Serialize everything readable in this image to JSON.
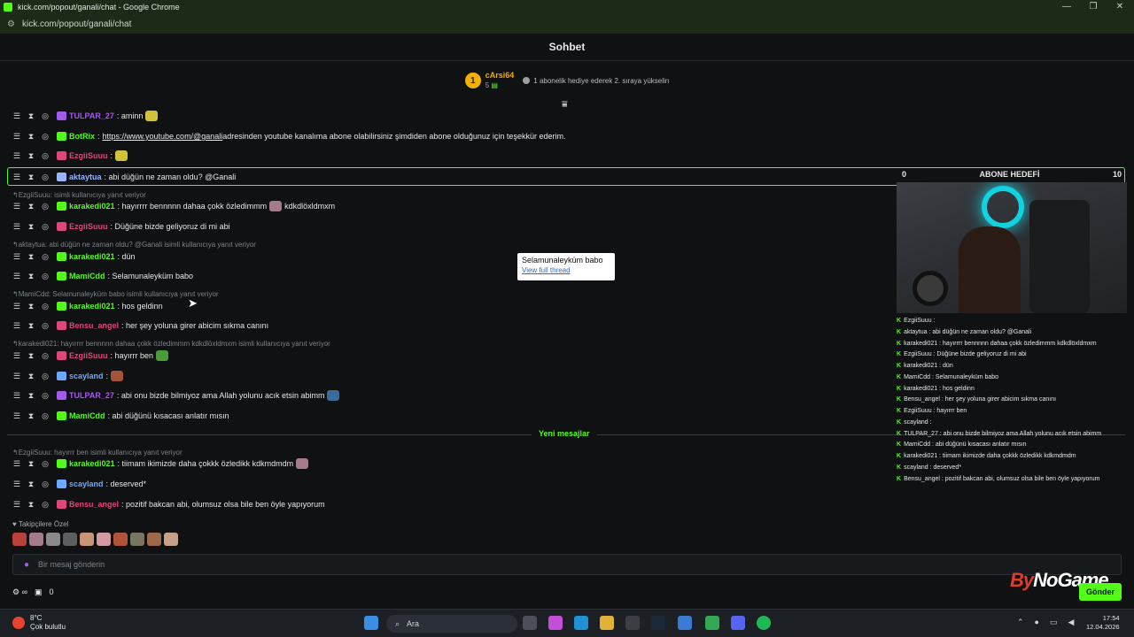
{
  "window": {
    "title": "kick.com/popout/ganali/chat - Google Chrome",
    "url": "kick.com/popout/ganali/chat"
  },
  "chat": {
    "title": "Sohbet"
  },
  "pinned": {
    "user": "cArsi64",
    "rank": "1",
    "count": "5",
    "hint": "1 abonelik hediye ederek 2. sıraya yükselin"
  },
  "messages": [
    {
      "user": "TULPAR_27",
      "color": "#a25be8",
      "text": ": aminn",
      "emote": true
    },
    {
      "user": "BotRix",
      "color": "#53fc18",
      "text": ":",
      "link": "https://www.youtube.com/@ganali",
      "after": " adresinden youtube kanalıma abone olabilirsiniz şimdiden abone olduğunuz için teşekkür ederim."
    },
    {
      "user": "EzgiiSuuu",
      "color": "#e0457b",
      "text": ":",
      "emote": true
    },
    {
      "user": "aktaytua",
      "color": "#9ab4ff",
      "text": ": abi düğün ne zaman oldu? @Ganali"
    },
    {
      "user": "karakedi021",
      "color": "#53fc18",
      "text": ": hayırrrr bennnnn dahaa çokk özledimmm",
      "after": " kdkdlöxldmxm",
      "emote": true
    },
    {
      "user": "EzgiiSuuu",
      "color": "#e0457b",
      "text": ": Düğüne bizde geliyoruz di mi abi"
    },
    {
      "user": "karakedi021",
      "color": "#53fc18",
      "text": ": dün"
    },
    {
      "user": "MamiCdd",
      "color": "#53fc18",
      "text": ": Selamunaleyküm babo"
    },
    {
      "user": "karakedi021",
      "color": "#53fc18",
      "text": ": hos geldinn"
    },
    {
      "user": "Bensu_angel",
      "color": "#e0457b",
      "text": ": her şey yoluna girer abicim sıkma canını"
    },
    {
      "user": "EzgiiSuuu",
      "color": "#e0457b",
      "text": ": hayırrr ben",
      "emote": true
    },
    {
      "user": "scayland",
      "color": "#6fa8ff",
      "text": ":",
      "emote": true
    },
    {
      "user": "TULPAR_27",
      "color": "#a25be8",
      "text": ": abi onu bizde bilmiyoz ama Allah yolunu acık etsin abimm",
      "emote": true
    },
    {
      "user": "MamiCdd",
      "color": "#53fc18",
      "text": ": abi düğünü kısacası anlatır mısın"
    },
    {
      "user": "karakedi021",
      "color": "#53fc18",
      "text": ": tiimam ikimizde daha çokkk özledikk kdkmdmdm",
      "emote": true
    },
    {
      "user": "scayland",
      "color": "#6fa8ff",
      "text": ": deserved*"
    },
    {
      "user": "Bensu_angel",
      "color": "#e0457b",
      "text": ": pozitif bakcan abi, olumsuz olsa bile ben öyle yapıyorum"
    }
  ],
  "replies": {
    "r1": "EzgiiSuuu: isimli kullanıcıya yanıt veriyor",
    "r2": "aktaytua: abi düğün ne zaman oldu? @Ganali isimli kullanıcıya yanıt veriyor",
    "r3": "MamiCdd: Selamunaleyküm babo isimli kullanıcıya yanıt veriyor",
    "r4": "karakedi021: hayırrrr bennnnn dahaa çokk özledimmm kdkdlöxldmxm isimli kullanıcıya yanıt veriyor",
    "r5": "EzgiiSuuu: hayırrr ben isimli kullanıcıya yanıt veriyor"
  },
  "divider": {
    "label": "Yeni mesajlar"
  },
  "tooltip": {
    "text": "Selamunaleyküm babo",
    "link": "View full thread"
  },
  "followers_label": "Takipçilere Özel",
  "input": {
    "placeholder": "Bir mesaj gönderin",
    "send_label": "Gönder",
    "count": "0"
  },
  "overlay": {
    "goal_left": "0",
    "goal_label": "ABONE HEDEFİ",
    "goal_right": "10"
  },
  "mini_chat": [
    "EzgiiSuuu :",
    "aktaytua : abi düğün ne zaman oldu? @Ganali",
    "karakedi021 : hayırrrr bennnnn dahaa çokk özledimmm kdkdlöxldmxm",
    "EzgiiSuuu : Düğüne bizde geliyoruz di mi abi",
    "karakedi021 : dün",
    "MamiCdd : Selamunaleyküm babo",
    "karakedi021 : hos geldinn",
    "Bensu_angel : her şey yoluna girer abicim sıkma canını",
    "EzgiiSuuu : hayırrr ben",
    "scayland :",
    "TULPAR_27 : abi onu bizde bilmiyoz ama Allah yolunu acık etsin abimm",
    "MamiCdd : abi düğünü kısacası anlatır mısın",
    "karakedi021 : tiimam ikimizde daha çokkk özledikk kdkmdmdm",
    "scayland : deserved*",
    "Bensu_angel : pozitif bakcan abi, olumsuz olsa bile ben öyle yapıyorum"
  ],
  "brand": {
    "by": "By",
    "name": "NoGame"
  },
  "taskbar": {
    "temp": "8°C",
    "weather": "Çok bulutlu",
    "search": "Ara",
    "time": "17:54",
    "date": "12.04.2026"
  },
  "colors": {
    "accent": "#53fc18",
    "bg": "#0f1112"
  }
}
